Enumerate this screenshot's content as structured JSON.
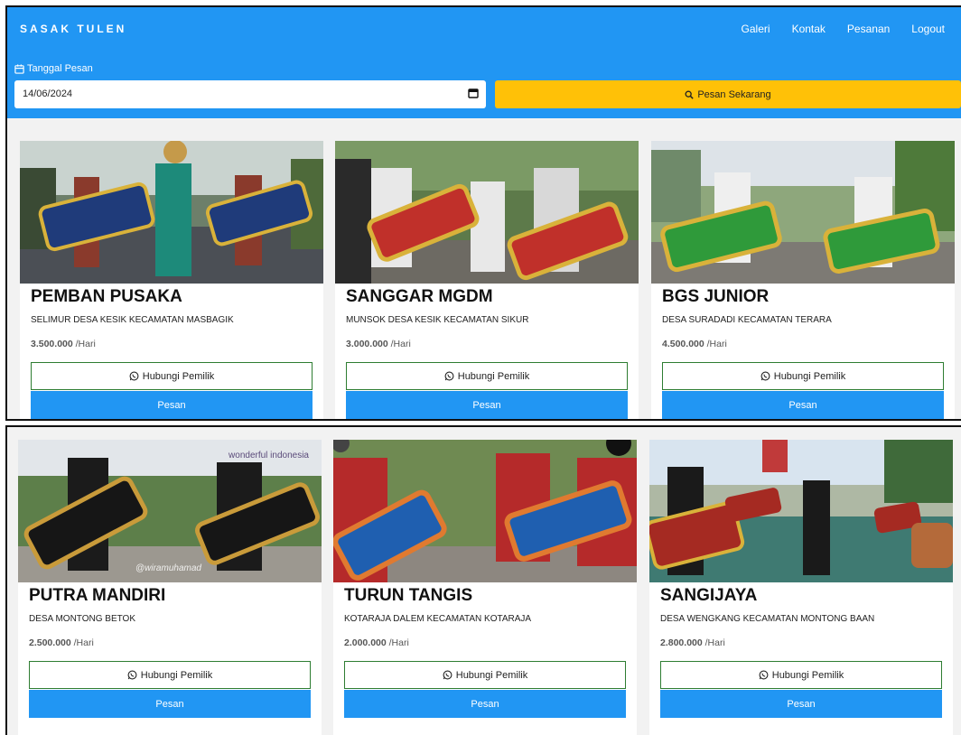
{
  "nav": {
    "brand": "SASAK TULEN",
    "links": [
      "Galeri",
      "Kontak",
      "Pesanan",
      "Logout"
    ]
  },
  "booking": {
    "date_label": "Tanggal Pesan",
    "date_value": "14/06/2024",
    "submit_label": "Pesan Sekarang"
  },
  "colors": {
    "primary": "#2196f3",
    "accent": "#ffc107",
    "contact_border": "#2e7d32"
  },
  "icons": {
    "calendar": "calendar-icon",
    "search": "search-icon",
    "whatsapp": "whatsapp-icon"
  },
  "watermarks": [
    "wonderful indonesia",
    "@wiramuhamad"
  ],
  "cards": [
    {
      "name": "PEMBAN PUSAKA",
      "location": "SELIMUR DESA KESIK KECAMATAN MASBAGIK",
      "price": "3.500.000",
      "unit": "/Hari",
      "contact_label": "Hubungi Pemilik",
      "order_label": "Pesan"
    },
    {
      "name": "SANGGAR MGDM",
      "location": "MUNSOK DESA KESIK KECAMATAN SIKUR",
      "price": "3.000.000",
      "unit": "/Hari",
      "contact_label": "Hubungi Pemilik",
      "order_label": "Pesan"
    },
    {
      "name": "BGS JUNIOR",
      "location": "DESA SURADADI KECAMATAN TERARA",
      "price": "4.500.000",
      "unit": "/Hari",
      "contact_label": "Hubungi Pemilik",
      "order_label": "Pesan"
    },
    {
      "name": "PUTRA MANDIRI",
      "location": "DESA MONTONG BETOK",
      "price": "2.500.000",
      "unit": "/Hari",
      "contact_label": "Hubungi Pemilik",
      "order_label": "Pesan"
    },
    {
      "name": "TURUN TANGIS",
      "location": "KOTARAJA DALEM KECAMATAN KOTARAJA",
      "price": "2.000.000",
      "unit": "/Hari",
      "contact_label": "Hubungi Pemilik",
      "order_label": "Pesan"
    },
    {
      "name": "SANGIJAYA",
      "location": "DESA WENGKANG KECAMATAN MONTONG BAAN",
      "price": "2.800.000",
      "unit": "/Hari",
      "contact_label": "Hubungi Pemilik",
      "order_label": "Pesan"
    }
  ]
}
